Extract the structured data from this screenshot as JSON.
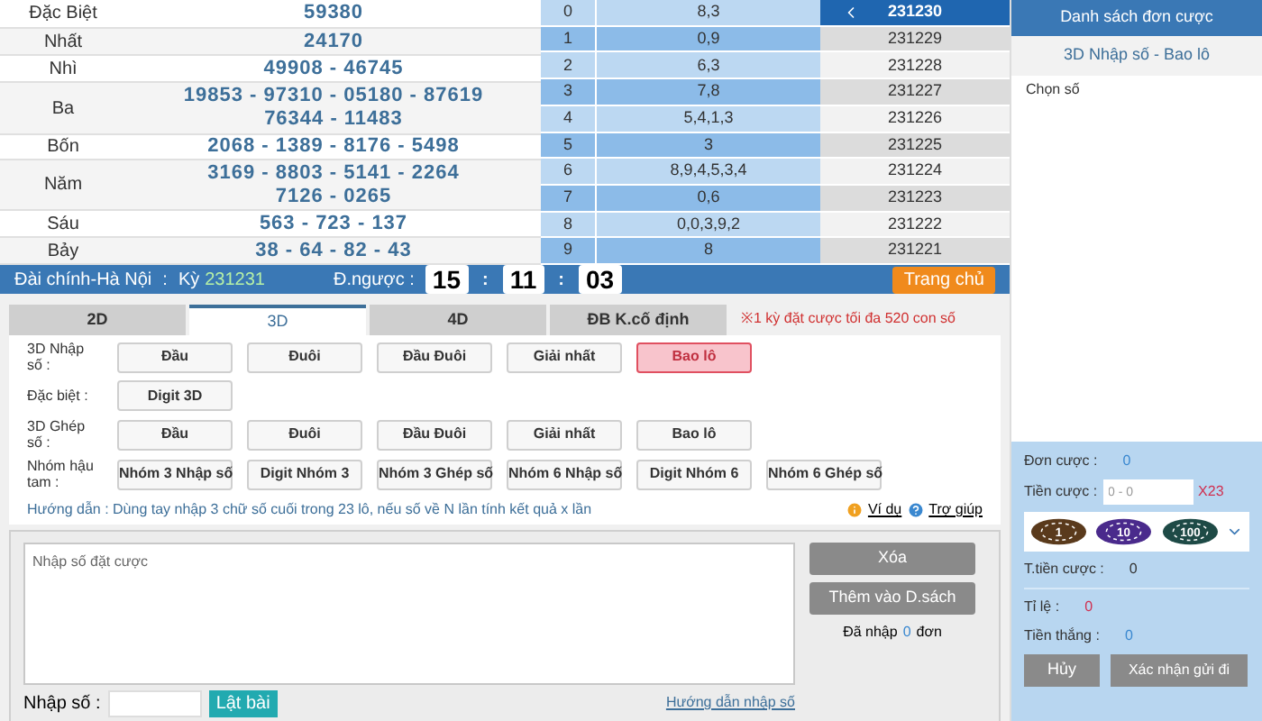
{
  "prizes": [
    {
      "label": "Đặc Biệt",
      "lines": [
        "59380"
      ]
    },
    {
      "label": "Nhất",
      "lines": [
        "24170"
      ]
    },
    {
      "label": "Nhì",
      "lines": [
        "49908 - 46745"
      ]
    },
    {
      "label": "Ba",
      "lines": [
        "19853 - 97310 - 05180 - 87619",
        "76344 - 11483"
      ]
    },
    {
      "label": "Bốn",
      "lines": [
        "2068 - 1389 - 8176 - 5498"
      ]
    },
    {
      "label": "Năm",
      "lines": [
        "3169 - 8803 - 5141 - 2264",
        "7126 - 0265"
      ]
    },
    {
      "label": "Sáu",
      "lines": [
        "563 - 723 - 137"
      ]
    },
    {
      "label": "Bảy",
      "lines": [
        "38 - 64 - 82 - 43"
      ]
    }
  ],
  "digits": [
    {
      "digit": "0",
      "values": "8,3"
    },
    {
      "digit": "1",
      "values": "0,9"
    },
    {
      "digit": "2",
      "values": "6,3"
    },
    {
      "digit": "3",
      "values": "7,8"
    },
    {
      "digit": "4",
      "values": "5,4,1,3"
    },
    {
      "digit": "5",
      "values": "3"
    },
    {
      "digit": "6",
      "values": "8,9,4,5,3,4"
    },
    {
      "digit": "7",
      "values": "0,6"
    },
    {
      "digit": "8",
      "values": "0,0,3,9,2"
    },
    {
      "digit": "9",
      "values": "8"
    }
  ],
  "periods": [
    {
      "label": "231230",
      "selected": true
    },
    {
      "label": "231229",
      "selected": false
    },
    {
      "label": "231228",
      "selected": false
    },
    {
      "label": "231227",
      "selected": false
    },
    {
      "label": "231226",
      "selected": false
    },
    {
      "label": "231225",
      "selected": false
    },
    {
      "label": "231224",
      "selected": false
    },
    {
      "label": "231223",
      "selected": false
    },
    {
      "label": "231222",
      "selected": false
    },
    {
      "label": "231221",
      "selected": false
    }
  ],
  "side": {
    "title": "Danh sách đơn cược",
    "subtitle": "3D Nhập số - Bao lô",
    "label": "Chọn số"
  },
  "status_bar": {
    "station": "Đài chính-Hà Nội",
    "colon": ":",
    "period_label": "Kỳ",
    "period": "231231",
    "countdown_label": "Đ.ngược :",
    "countdown": [
      "15",
      "11",
      "03"
    ],
    "separator": ":",
    "home": "Trang chủ"
  },
  "tabs": [
    {
      "label": "2D",
      "selected": false
    },
    {
      "label": "3D",
      "selected": true
    },
    {
      "label": "4D",
      "selected": false
    },
    {
      "label": "ĐB K.cố định",
      "selected": false
    }
  ],
  "notice": "※1 kỳ đặt cược tối đa 520 con số",
  "option_rows": [
    {
      "label": "3D Nhập số :",
      "buttons": [
        {
          "label": "Đầu",
          "selected": false
        },
        {
          "label": "Đuôi",
          "selected": false
        },
        {
          "label": "Đầu Đuôi",
          "selected": false
        },
        {
          "label": "Giải nhất",
          "selected": false
        },
        {
          "label": "Bao lô",
          "selected": true
        }
      ]
    },
    {
      "label": "Đặc biệt :",
      "buttons": [
        {
          "label": "Digit 3D",
          "selected": false
        }
      ]
    },
    {
      "label": "3D Ghép số :",
      "buttons": [
        {
          "label": "Đầu",
          "selected": false
        },
        {
          "label": "Đuôi",
          "selected": false
        },
        {
          "label": "Đầu Đuôi",
          "selected": false
        },
        {
          "label": "Giải nhất",
          "selected": false
        },
        {
          "label": "Bao lô",
          "selected": false
        }
      ]
    },
    {
      "label": "Nhóm hậu tam :",
      "buttons": [
        {
          "label": "Nhóm 3 Nhập số",
          "selected": false
        },
        {
          "label": "Digit Nhóm 3",
          "selected": false
        },
        {
          "label": "Nhóm 3 Ghép số",
          "selected": false
        },
        {
          "label": "Nhóm 6 Nhập số",
          "selected": false
        },
        {
          "label": "Digit Nhóm 6",
          "selected": false
        },
        {
          "label": "Nhóm 6 Ghép số",
          "selected": false
        }
      ]
    }
  ],
  "guide": "Hướng dẫn : Dùng tay nhập 3 chữ số cuối trong 23 lô, nếu số về N lần tính kết quả x lần",
  "example_link": "Ví dụ",
  "help_link": "Trợ giúp",
  "entry": {
    "placeholder": "Nhập số đặt cược",
    "clear": "Xóa",
    "add": "Thêm vào D.sách",
    "count_prefix": "Đã nhập",
    "count": "0",
    "count_suffix": "đơn",
    "number_label": "Nhập số :",
    "flip": "Lật bài",
    "howto": "Hướng dẫn nhập số"
  },
  "bet": {
    "orders_label": "Đơn cược :",
    "orders": "0",
    "amount_label": "Tiền cược :",
    "amount_placeholder": "0 - 0",
    "multiplier": "X23",
    "chips": [
      {
        "label": "1",
        "color": "#5a3a1c"
      },
      {
        "label": "10",
        "color": "#4a2a8c"
      },
      {
        "label": "100",
        "color": "#1e4a46"
      }
    ],
    "total_label": "T.tiền cược :",
    "total": "0",
    "rate_label": "Tỉ lệ :",
    "rate": "0",
    "win_label": "Tiền thắng :",
    "win": "0",
    "cancel": "Hủy",
    "confirm": "Xác nhận gửi đi"
  }
}
